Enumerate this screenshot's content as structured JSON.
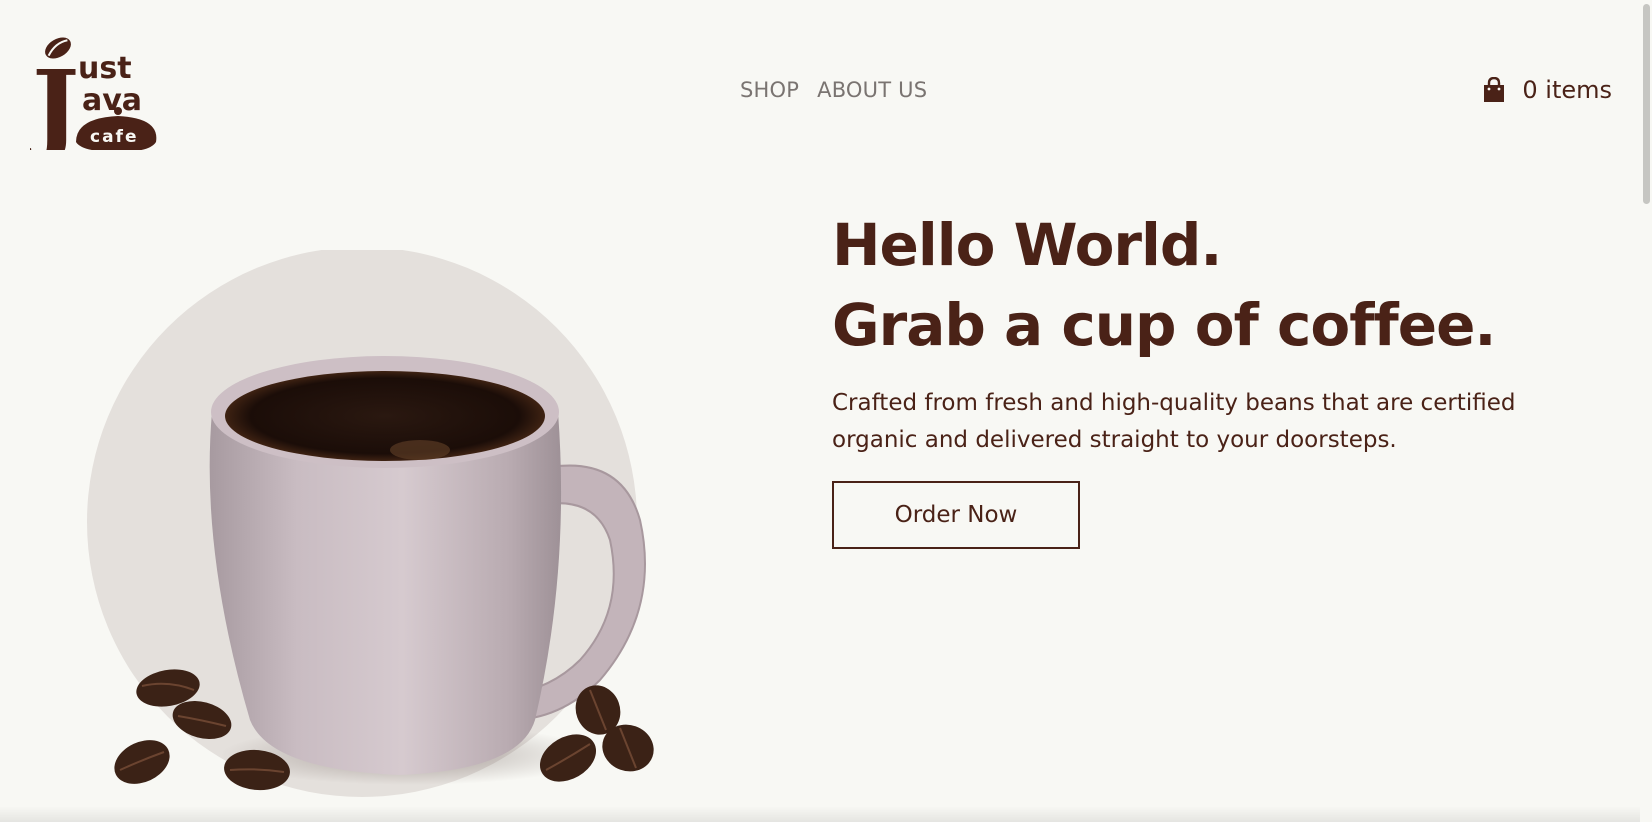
{
  "brand": {
    "logo_line1": "ust",
    "logo_line2": "ava",
    "logo_line3": "cafe",
    "logo_letter": "J",
    "color_primary": "#4a2217",
    "color_background": "#f8f8f4"
  },
  "nav": {
    "items": [
      {
        "label": "SHOP"
      },
      {
        "label": "ABOUT US"
      }
    ]
  },
  "cart": {
    "icon": "shopping-bag-icon",
    "label": "0 items"
  },
  "hero": {
    "title_line1": "Hello World.",
    "title_line2": "Grab a cup of coffee.",
    "description": "Crafted from fresh and high-quality beans that are certified organic and delivered straight to your doorsteps.",
    "cta_label": "Order Now",
    "image": "coffee-mug-with-beans"
  }
}
